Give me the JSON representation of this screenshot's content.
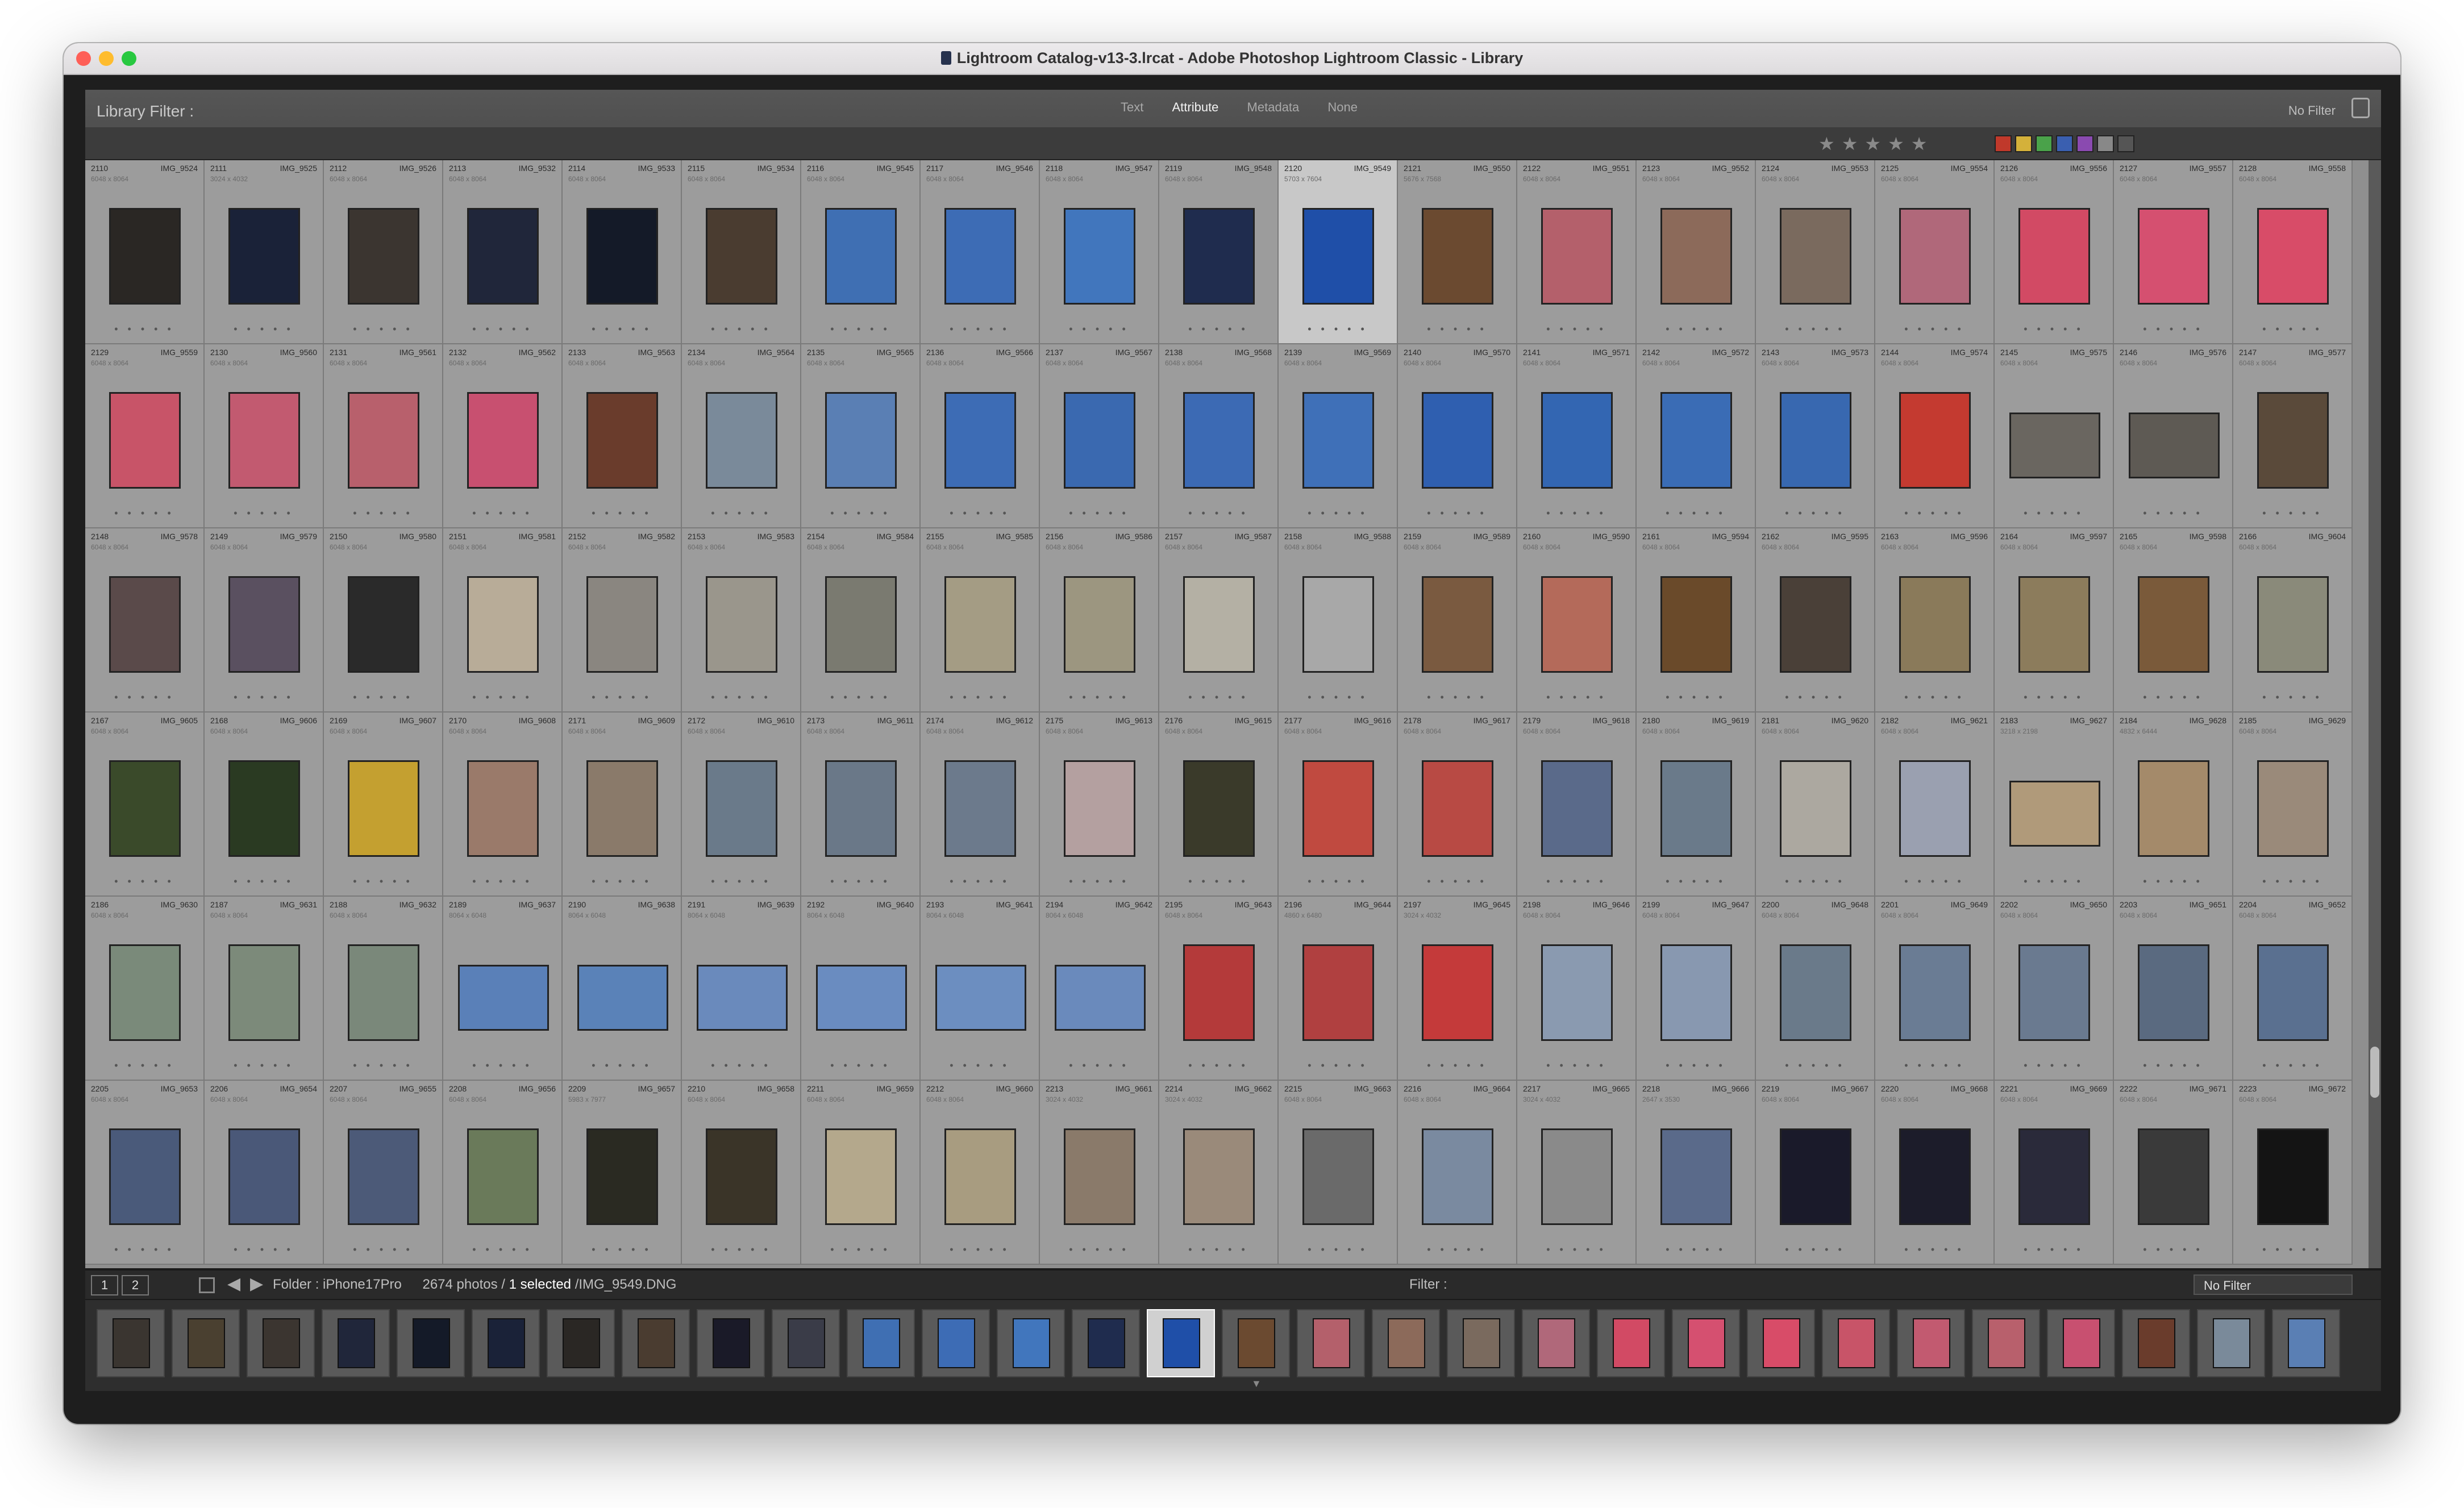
{
  "window": {
    "title": "Lightroom Catalog-v13-3.lrcat - Adobe Photoshop Lightroom Classic - Library"
  },
  "filter_bar": {
    "label": "Library Filter :",
    "tabs": [
      "Text",
      "Attribute",
      "Metadata",
      "None"
    ],
    "active_tab": "Attribute",
    "preset": "No Filter"
  },
  "grid": {
    "rows": [
      {
        "cells": [
          {
            "num": "2110",
            "name": "IMG_9524",
            "dim": "6048 x 8064",
            "color": "#2a2724"
          },
          {
            "num": "2111",
            "name": "IMG_9525",
            "dim": "3024 x 4032",
            "color": "#1a2238"
          },
          {
            "num": "2112",
            "name": "IMG_9526",
            "dim": "6048 x 8064",
            "color": "#3b3530"
          },
          {
            "num": "2113",
            "name": "IMG_9532",
            "dim": "6048 x 8064",
            "color": "#20263a"
          },
          {
            "num": "2114",
            "name": "IMG_9533",
            "dim": "6048 x 8064",
            "color": "#141a28"
          },
          {
            "num": "2115",
            "name": "IMG_9534",
            "dim": "6048 x 8064",
            "color": "#4a3c30"
          },
          {
            "num": "2116",
            "name": "IMG_9545",
            "dim": "6048 x 8064",
            "color": "#3f6fb3"
          },
          {
            "num": "2117",
            "name": "IMG_9546",
            "dim": "6048 x 8064",
            "color": "#3d6cb5"
          },
          {
            "num": "2118",
            "name": "IMG_9547",
            "dim": "6048 x 8064",
            "color": "#4176bd"
          },
          {
            "num": "2119",
            "name": "IMG_9548",
            "dim": "6048 x 8064",
            "color": "#1f2c4e"
          },
          {
            "num": "2120",
            "name": "IMG_9549",
            "dim": "5703 x 7604",
            "color": "#1f4fa8",
            "selected": true
          },
          {
            "num": "2121",
            "name": "IMG_9550",
            "dim": "5676 x 7568",
            "color": "#6b4a30"
          },
          {
            "num": "2122",
            "name": "IMG_9551",
            "dim": "6048 x 8064",
            "color": "#b4606b"
          },
          {
            "num": "2123",
            "name": "IMG_9552",
            "dim": "6048 x 8064",
            "color": "#8c6a5a"
          },
          {
            "num": "2124",
            "name": "IMG_9553",
            "dim": "6048 x 8064",
            "color": "#7a6a5e"
          },
          {
            "num": "2125",
            "name": "IMG_9554",
            "dim": "6048 x 8064",
            "color": "#b0687a"
          },
          {
            "num": "2126",
            "name": "IMG_9556",
            "dim": "6048 x 8064",
            "color": "#d24a64"
          },
          {
            "num": "2127",
            "name": "IMG_9557",
            "dim": "6048 x 8064",
            "color": "#d55070"
          },
          {
            "num": "2128",
            "name": "IMG_9558",
            "dim": "6048 x 8064",
            "color": "#d84c68"
          }
        ]
      },
      {
        "cells": [
          {
            "num": "2129",
            "name": "IMG_9559",
            "dim": "6048 x 8064",
            "color": "#c85468"
          },
          {
            "num": "2130",
            "name": "IMG_9560",
            "dim": "6048 x 8064",
            "color": "#c25a70"
          },
          {
            "num": "2131",
            "name": "IMG_9561",
            "dim": "6048 x 8064",
            "color": "#b8606c"
          },
          {
            "num": "2132",
            "name": "IMG_9562",
            "dim": "6048 x 8064",
            "color": "#c85070"
          },
          {
            "num": "2133",
            "name": "IMG_9563",
            "dim": "6048 x 8064",
            "color": "#6a3c2c"
          },
          {
            "num": "2134",
            "name": "IMG_9564",
            "dim": "6048 x 8064",
            "color": "#7a8a9a"
          },
          {
            "num": "2135",
            "name": "IMG_9565",
            "dim": "6048 x 8064",
            "color": "#5a7fb4"
          },
          {
            "num": "2136",
            "name": "IMG_9566",
            "dim": "6048 x 8064",
            "color": "#3d6cb5"
          },
          {
            "num": "2137",
            "name": "IMG_9567",
            "dim": "6048 x 8064",
            "color": "#3a69b0"
          },
          {
            "num": "2138",
            "name": "IMG_9568",
            "dim": "6048 x 8064",
            "color": "#3c6ab4"
          },
          {
            "num": "2139",
            "name": "IMG_9569",
            "dim": "6048 x 8064",
            "color": "#3f70b8"
          },
          {
            "num": "2140",
            "name": "IMG_9570",
            "dim": "6048 x 8064",
            "color": "#2f5fb0"
          },
          {
            "num": "2141",
            "name": "IMG_9571",
            "dim": "6048 x 8064",
            "color": "#3366b2"
          },
          {
            "num": "2142",
            "name": "IMG_9572",
            "dim": "6048 x 8064",
            "color": "#3a6cb5"
          },
          {
            "num": "2143",
            "name": "IMG_9573",
            "dim": "6048 x 8064",
            "color": "#3868b0"
          },
          {
            "num": "2144",
            "name": "IMG_9574",
            "dim": "6048 x 8064",
            "color": "#c43a30"
          },
          {
            "num": "2145",
            "name": "IMG_9575",
            "dim": "6048 x 8064",
            "color": "#6a6660",
            "wide": true
          },
          {
            "num": "2146",
            "name": "IMG_9576",
            "dim": "6048 x 8064",
            "color": "#5e5a54",
            "wide": true
          },
          {
            "num": "2147",
            "name": "IMG_9577",
            "dim": "6048 x 8064",
            "color": "#5a4a3a"
          }
        ]
      },
      {
        "cells": [
          {
            "num": "2148",
            "name": "IMG_9578",
            "dim": "6048 x 8064",
            "color": "#5a4a4a"
          },
          {
            "num": "2149",
            "name": "IMG_9579",
            "dim": "6048 x 8064",
            "color": "#5a5060"
          },
          {
            "num": "2150",
            "name": "IMG_9580",
            "dim": "6048 x 8064",
            "color": "#2a2a2a"
          },
          {
            "num": "2151",
            "name": "IMG_9581",
            "dim": "6048 x 8064",
            "color": "#b8ac98"
          },
          {
            "num": "2152",
            "name": "IMG_9582",
            "dim": "6048 x 8064",
            "color": "#8a8680"
          },
          {
            "num": "2153",
            "name": "IMG_9583",
            "dim": "6048 x 8064",
            "color": "#9a968c"
          },
          {
            "num": "2154",
            "name": "IMG_9584",
            "dim": "6048 x 8064",
            "color": "#7a7a70"
          },
          {
            "num": "2155",
            "name": "IMG_9585",
            "dim": "6048 x 8064",
            "color": "#a49c84"
          },
          {
            "num": "2156",
            "name": "IMG_9586",
            "dim": "6048 x 8064",
            "color": "#9c9680"
          },
          {
            "num": "2157",
            "name": "IMG_9587",
            "dim": "6048 x 8064",
            "color": "#b4b0a4"
          },
          {
            "num": "2158",
            "name": "IMG_9588",
            "dim": "6048 x 8064",
            "color": "#a8a8a8"
          },
          {
            "num": "2159",
            "name": "IMG_9589",
            "dim": "6048 x 8064",
            "color": "#7a5a40"
          },
          {
            "num": "2160",
            "name": "IMG_9590",
            "dim": "6048 x 8064",
            "color": "#b46a5a"
          },
          {
            "num": "2161",
            "name": "IMG_9594",
            "dim": "6048 x 8064",
            "color": "#6a4a2a"
          },
          {
            "num": "2162",
            "name": "IMG_9595",
            "dim": "6048 x 8064",
            "color": "#4a4038"
          },
          {
            "num": "2163",
            "name": "IMG_9596",
            "dim": "6048 x 8064",
            "color": "#8a7a5a"
          },
          {
            "num": "2164",
            "name": "IMG_9597",
            "dim": "6048 x 8064",
            "color": "#8c7c5c"
          },
          {
            "num": "2165",
            "name": "IMG_9598",
            "dim": "6048 x 8064",
            "color": "#7a5a3a"
          },
          {
            "num": "2166",
            "name": "IMG_9604",
            "dim": "6048 x 8064",
            "color": "#8a8a7a"
          }
        ]
      },
      {
        "cells": [
          {
            "num": "2167",
            "name": "IMG_9605",
            "dim": "6048 x 8064",
            "color": "#3a4a2a"
          },
          {
            "num": "2168",
            "name": "IMG_9606",
            "dim": "6048 x 8064",
            "color": "#2a3a22"
          },
          {
            "num": "2169",
            "name": "IMG_9607",
            "dim": "6048 x 8064",
            "color": "#c4a030"
          },
          {
            "num": "2170",
            "name": "IMG_9608",
            "dim": "6048 x 8064",
            "color": "#9a7a6a"
          },
          {
            "num": "2171",
            "name": "IMG_9609",
            "dim": "6048 x 8064",
            "color": "#8a7a6a"
          },
          {
            "num": "2172",
            "name": "IMG_9610",
            "dim": "6048 x 8064",
            "color": "#6a7a8a"
          },
          {
            "num": "2173",
            "name": "IMG_9611",
            "dim": "6048 x 8064",
            "color": "#6a7888"
          },
          {
            "num": "2174",
            "name": "IMG_9612",
            "dim": "6048 x 8064",
            "color": "#6c7a8c"
          },
          {
            "num": "2175",
            "name": "IMG_9613",
            "dim": "6048 x 8064",
            "color": "#b4a0a0"
          },
          {
            "num": "2176",
            "name": "IMG_9615",
            "dim": "6048 x 8064",
            "color": "#3a3a2a"
          },
          {
            "num": "2177",
            "name": "IMG_9616",
            "dim": "6048 x 8064",
            "color": "#c04a40"
          },
          {
            "num": "2178",
            "name": "IMG_9617",
            "dim": "6048 x 8064",
            "color": "#b84a44"
          },
          {
            "num": "2179",
            "name": "IMG_9618",
            "dim": "6048 x 8064",
            "color": "#5a6a8a"
          },
          {
            "num": "2180",
            "name": "IMG_9619",
            "dim": "6048 x 8064",
            "color": "#6a7a8a"
          },
          {
            "num": "2181",
            "name": "IMG_9620",
            "dim": "6048 x 8064",
            "color": "#aca8a0"
          },
          {
            "num": "2182",
            "name": "IMG_9621",
            "dim": "6048 x 8064",
            "color": "#9aa0b0"
          },
          {
            "num": "2183",
            "name": "IMG_9627",
            "dim": "3218 x 2198",
            "color": "#b09a7a",
            "wide": true
          },
          {
            "num": "2184",
            "name": "IMG_9628",
            "dim": "4832 x 6444",
            "color": "#a48a6a"
          },
          {
            "num": "2185",
            "name": "IMG_9629",
            "dim": "6048 x 8064",
            "color": "#9a8a7a"
          }
        ]
      },
      {
        "cells": [
          {
            "num": "2186",
            "name": "IMG_9630",
            "dim": "6048 x 8064",
            "color": "#7a8a7a"
          },
          {
            "num": "2187",
            "name": "IMG_9631",
            "dim": "6048 x 8064",
            "color": "#7c8a7a"
          },
          {
            "num": "2188",
            "name": "IMG_9632",
            "dim": "6048 x 8064",
            "color": "#7a887a"
          },
          {
            "num": "2189",
            "name": "IMG_9637",
            "dim": "8064 x 6048",
            "color": "#5a80b8",
            "wide": true
          },
          {
            "num": "2190",
            "name": "IMG_9638",
            "dim": "8064 x 6048",
            "color": "#5a82b8",
            "wide": true
          },
          {
            "num": "2191",
            "name": "IMG_9639",
            "dim": "8064 x 6048",
            "color": "#6a8abc",
            "wide": true
          },
          {
            "num": "2192",
            "name": "IMG_9640",
            "dim": "8064 x 6048",
            "color": "#6a8cc0",
            "wide": true
          },
          {
            "num": "2193",
            "name": "IMG_9641",
            "dim": "8064 x 6048",
            "color": "#6c8ec0",
            "wide": true
          },
          {
            "num": "2194",
            "name": "IMG_9642",
            "dim": "8064 x 6048",
            "color": "#6a8abc",
            "wide": true
          },
          {
            "num": "2195",
            "name": "IMG_9643",
            "dim": "6048 x 8064",
            "color": "#b43a3a"
          },
          {
            "num": "2196",
            "name": "IMG_9644",
            "dim": "4860 x 6480",
            "color": "#b04040"
          },
          {
            "num": "2197",
            "name": "IMG_9645",
            "dim": "3024 x 4032",
            "color": "#c43a3a"
          },
          {
            "num": "2198",
            "name": "IMG_9646",
            "dim": "6048 x 8064",
            "color": "#8a9ab0"
          },
          {
            "num": "2199",
            "name": "IMG_9647",
            "dim": "6048 x 8064",
            "color": "#8898b0"
          },
          {
            "num": "2200",
            "name": "IMG_9648",
            "dim": "6048 x 8064",
            "color": "#6a7a8a"
          },
          {
            "num": "2201",
            "name": "IMG_9649",
            "dim": "6048 x 8064",
            "color": "#6a7c94"
          },
          {
            "num": "2202",
            "name": "IMG_9650",
            "dim": "6048 x 8064",
            "color": "#6a7a90"
          },
          {
            "num": "2203",
            "name": "IMG_9651",
            "dim": "6048 x 8064",
            "color": "#5a6a80"
          },
          {
            "num": "2204",
            "name": "IMG_9652",
            "dim": "6048 x 8064",
            "color": "#5a7090"
          }
        ]
      },
      {
        "cells": [
          {
            "num": "2205",
            "name": "IMG_9653",
            "dim": "6048 x 8064",
            "color": "#4a5a7a"
          },
          {
            "num": "2206",
            "name": "IMG_9654",
            "dim": "6048 x 8064",
            "color": "#4a5878"
          },
          {
            "num": "2207",
            "name": "IMG_9655",
            "dim": "6048 x 8064",
            "color": "#4c5a78"
          },
          {
            "num": "2208",
            "name": "IMG_9656",
            "dim": "6048 x 8064",
            "color": "#6a7a5a"
          },
          {
            "num": "2209",
            "name": "IMG_9657",
            "dim": "5983 x 7977",
            "color": "#2a2a22"
          },
          {
            "num": "2210",
            "name": "IMG_9658",
            "dim": "6048 x 8064",
            "color": "#3a3428"
          },
          {
            "num": "2211",
            "name": "IMG_9659",
            "dim": "6048 x 8064",
            "color": "#b4a88c"
          },
          {
            "num": "2212",
            "name": "IMG_9660",
            "dim": "6048 x 8064",
            "color": "#a89c80"
          },
          {
            "num": "2213",
            "name": "IMG_9661",
            "dim": "3024 x 4032",
            "color": "#8a7a6a"
          },
          {
            "num": "2214",
            "name": "IMG_9662",
            "dim": "3024 x 4032",
            "color": "#9a8a7a"
          },
          {
            "num": "2215",
            "name": "IMG_9663",
            "dim": "6048 x 8064",
            "color": "#6a6a6a"
          },
          {
            "num": "2216",
            "name": "IMG_9664",
            "dim": "6048 x 8064",
            "color": "#7a8aa0"
          },
          {
            "num": "2217",
            "name": "IMG_9665",
            "dim": "3024 x 4032",
            "color": "#8a8a8a"
          },
          {
            "num": "2218",
            "name": "IMG_9666",
            "dim": "2647 x 3530",
            "color": "#5a6a8a"
          },
          {
            "num": "2219",
            "name": "IMG_9667",
            "dim": "6048 x 8064",
            "color": "#1a1a2a"
          },
          {
            "num": "2220",
            "name": "IMG_9668",
            "dim": "6048 x 8064",
            "color": "#1c1c2a"
          },
          {
            "num": "2221",
            "name": "IMG_9669",
            "dim": "6048 x 8064",
            "color": "#2a2a3a"
          },
          {
            "num": "2222",
            "name": "IMG_9671",
            "dim": "6048 x 8064",
            "color": "#3a3a3a"
          },
          {
            "num": "2223",
            "name": "IMG_9672",
            "dim": "6048 x 8064",
            "color": "#141414"
          }
        ]
      }
    ]
  },
  "toolbar": {
    "page1": "1",
    "page2": "2",
    "folder_label": "Folder : iPhone17Pro",
    "photo_count": "2674 photos /",
    "selected_text": "1 selected",
    "selected_file": "/IMG_9549.DNG",
    "filter_label": "Filter :",
    "filter_value": "No Filter"
  },
  "filmstrip": {
    "colors": [
      "#3a3530",
      "#4a4030",
      "#3b3530",
      "#20263a",
      "#141a28",
      "#1a2238",
      "#2a2724",
      "#4a3c30",
      "#1a1a28",
      "#3a3c48",
      "#3f6fb3",
      "#3d6cb5",
      "#4176bd",
      "#1f2c4e",
      "#1f4fa8",
      "#6b4a30",
      "#b4606b",
      "#8c6a5a",
      "#7a6a5e",
      "#b0687a",
      "#d24a64",
      "#d55070",
      "#d84c68",
      "#c85468",
      "#c25a70",
      "#b8606c",
      "#c85070",
      "#6a3c2c",
      "#7a8a9a",
      "#5a7fb4"
    ],
    "selected_index": 14
  },
  "accent_colors": {
    "selection": "#c8c8c8",
    "grid_bg": "#9c9c9c",
    "chrome_dark": "#1e1e1e"
  }
}
